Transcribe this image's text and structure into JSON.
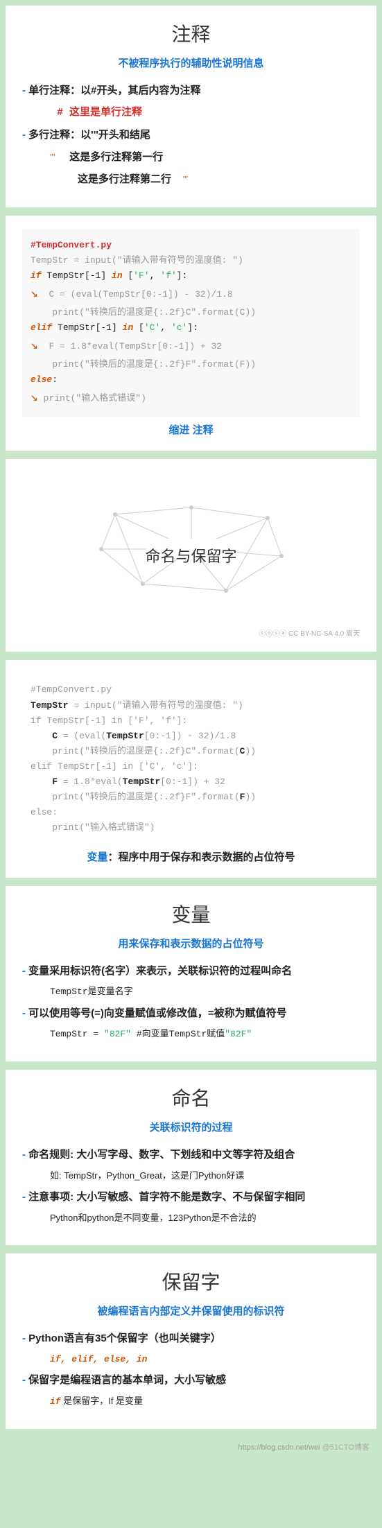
{
  "cards": {
    "c1": {
      "title": "注释",
      "subtitle": "不被程序执行的辅助性说明信息",
      "bullet1": "单行注释：以#开头，其后内容为注释",
      "code1": "#  这里是单行注释",
      "bullet2": "多行注释：以'''开头和结尾",
      "code2_prefix": "'''",
      "code2a": "这是多行注释第一行",
      "code2b": "这是多行注释第二行",
      "code2_suffix": "'''"
    },
    "c2": {
      "code": {
        "l1": "#TempConvert.py",
        "l2a": "TempStr = input(",
        "l2b": "\"请输入带有符号的温度值: \"",
        "l2c": ")",
        "l3a": "if",
        "l3b": " TempStr[-1] ",
        "l3c": "in",
        "l3d": " [",
        "l3e": "'F'",
        "l3f": ", ",
        "l3g": "'f'",
        "l3h": "]:",
        "l4": "C = (eval(TempStr[0:-1]) - 32)/1.8",
        "l5a": "print(",
        "l5b": "\"转换后的温度是{:.2f}C\"",
        "l5c": ".format(C))",
        "l6a": "elif",
        "l6b": " TempStr[-1] ",
        "l6c": "in",
        "l6d": " [",
        "l6e": "'C'",
        "l6f": ", ",
        "l6g": "'c'",
        "l6h": "]:",
        "l7": "F = 1.8*eval(TempStr[0:-1]) + 32",
        "l8a": "print(",
        "l8b": "\"转换后的温度是{:.2f}F\"",
        "l8c": ".format(F))",
        "l9a": "else",
        "l9b": ":",
        "l10a": "print(",
        "l10b": "\"输入格式错误\"",
        "l10c": ")"
      },
      "note": "缩进  注释"
    },
    "c3": {
      "title": "命名与保留字",
      "cc": "CC BY-NC-SA 4.0 嵩天"
    },
    "c4": {
      "code": {
        "l1": "#TempConvert.py",
        "l2": "TempStr",
        "l2b": " = input(\"请输入带有符号的温度值: \")",
        "l3": "if TempStr[-1] in ['F', 'f']:",
        "l4a": "C",
        "l4b": " = (eval(",
        "l4c": "TempStr",
        "l4d": "[0:-1]) - 32)/1.8",
        "l5a": "print(\"转换后的温度是{:.2f}C\".format(",
        "l5b": "C",
        "l5c": "))",
        "l6": "elif TempStr[-1] in ['C', 'c']:",
        "l7a": "F",
        "l7b": " = 1.8*eval(",
        "l7c": "TempStr",
        "l7d": "[0:-1]) + 32",
        "l8a": "print(\"转换后的温度是{:.2f}F\".format(",
        "l8b": "F",
        "l8c": "))",
        "l9": "else:",
        "l10": "print(\"输入格式错误\")"
      },
      "label": "变量",
      "note": "程序中用于保存和表示数据的占位符号"
    },
    "c5": {
      "title": "变量",
      "subtitle": "用来保存和表示数据的占位符号",
      "b1": "变量采用标识符(名字）来表示，关联标识符的过程叫命名",
      "b1sub": "TempStr是变量名字",
      "b2": "可以使用等号(=)向变量赋值或修改值，=被称为赋值符号",
      "b2sub_a": "TempStr = ",
      "b2sub_b": "\"82F\"",
      "b2sub_c": "    #向变量TempStr赋值",
      "b2sub_d": "\"82F\""
    },
    "c6": {
      "title": "命名",
      "subtitle": "关联标识符的过程",
      "b1": "命名规则: 大小写字母、数字、下划线和中文等字符及组合",
      "b1sub": "如: TempStr，Python_Great，这是门Python好课",
      "b2": "注意事项: 大小写敏感、首字符不能是数字、不与保留字相同",
      "b2sub": "Python和python是不同变量，123Python是不合法的"
    },
    "c7": {
      "title": "保留字",
      "subtitle": "被编程语言内部定义并保留使用的标识符",
      "b1": "Python语言有35个保留字（也叫关键字）",
      "b1sub": "if, elif, else, in",
      "b2": "保留字是编程语言的基本单词，大小写敏感",
      "b2sub_a": "if",
      "b2sub_b": " 是保留字，If 是变量"
    },
    "footer": "@51CTO博客"
  }
}
